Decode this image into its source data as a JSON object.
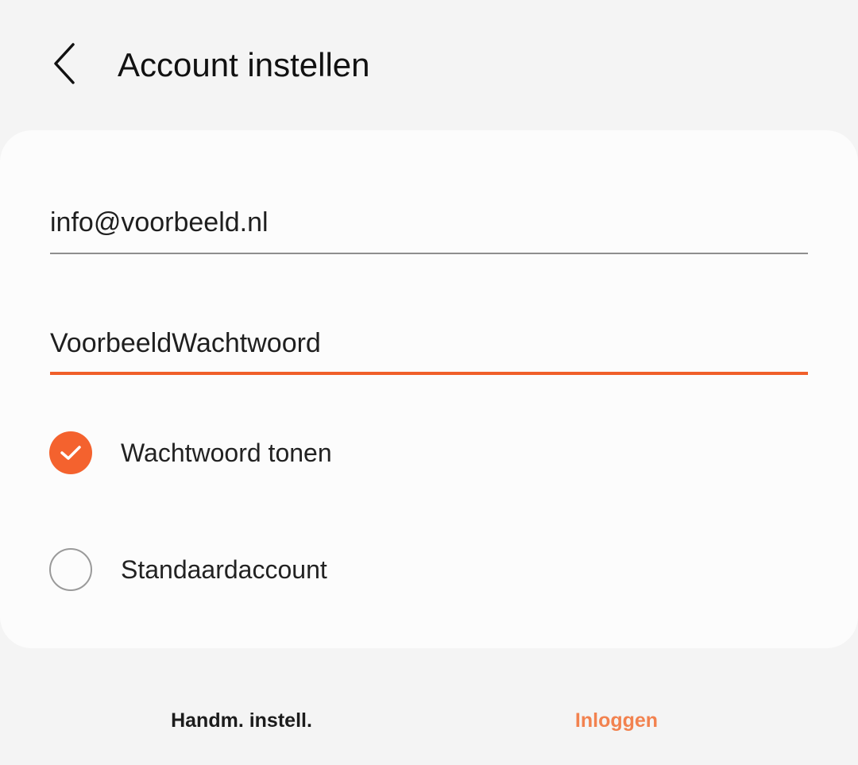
{
  "header": {
    "title": "Account instellen",
    "back_icon": "chevron-left-icon"
  },
  "form": {
    "email": {
      "value": "info@voorbeeld.nl"
    },
    "password": {
      "value": "VoorbeeldWachtwoord",
      "focused": true
    },
    "show_password": {
      "label": "Wachtwoord tonen",
      "checked": true
    },
    "default_account": {
      "label": "Standaardaccount",
      "checked": false
    }
  },
  "actions": {
    "manual_label": "Handm. instell.",
    "login_label": "Inloggen"
  },
  "colors": {
    "accent": "#f4622e",
    "login_text": "#f2824f",
    "background": "#f4f4f4",
    "card": "#fcfcfc"
  }
}
